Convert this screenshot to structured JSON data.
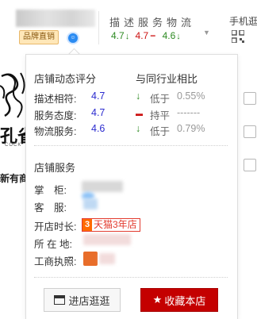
{
  "header": {
    "badge": "品牌直销",
    "score_labels": "描述服务物流",
    "scores": [
      {
        "value": "4.7",
        "trend": "down",
        "color": "#2d8a22"
      },
      {
        "value": "4.7",
        "trend": "flat",
        "color": "#cc1111"
      },
      {
        "value": "4.6",
        "trend": "down",
        "color": "#2d8a22"
      }
    ],
    "right_nav_label": "手机逛",
    "dropdown_icon": "triangle-down-icon"
  },
  "left_strip": {
    "logo_text": "孔雀",
    "logo_sub": "COCK",
    "link_text": "新有商"
  },
  "panel": {
    "dynamic_title": "店铺动态评分",
    "compare_title": "与同行业相比",
    "ratings": [
      {
        "label": "描述相符:",
        "value": "4.7",
        "indicator": "↓",
        "compare": "低于",
        "percent": "0.55%"
      },
      {
        "label": "服务态度:",
        "value": "4.7",
        "indicator": "▬",
        "compare": "持平",
        "percent": "-------"
      },
      {
        "label": "物流服务:",
        "value": "4.6",
        "indicator": "↓",
        "compare": "低于",
        "percent": "0.79%"
      }
    ],
    "service_title": "店铺服务",
    "services": [
      {
        "label": "掌　柜:"
      },
      {
        "label": "客　服:"
      },
      {
        "label": "开店时长:"
      },
      {
        "label": "所 在 地:"
      },
      {
        "label": "工商执照:"
      }
    ],
    "tmall": {
      "num": "3",
      "text": "天猫3年店"
    },
    "enter_button": "进店逛逛",
    "favorite_button": "收藏本店",
    "colors": {
      "favorite_bg": "#c40000",
      "value_blue": "#2b2bcf",
      "down_green": "#2d8a22",
      "flat_red": "#cc1111"
    }
  }
}
